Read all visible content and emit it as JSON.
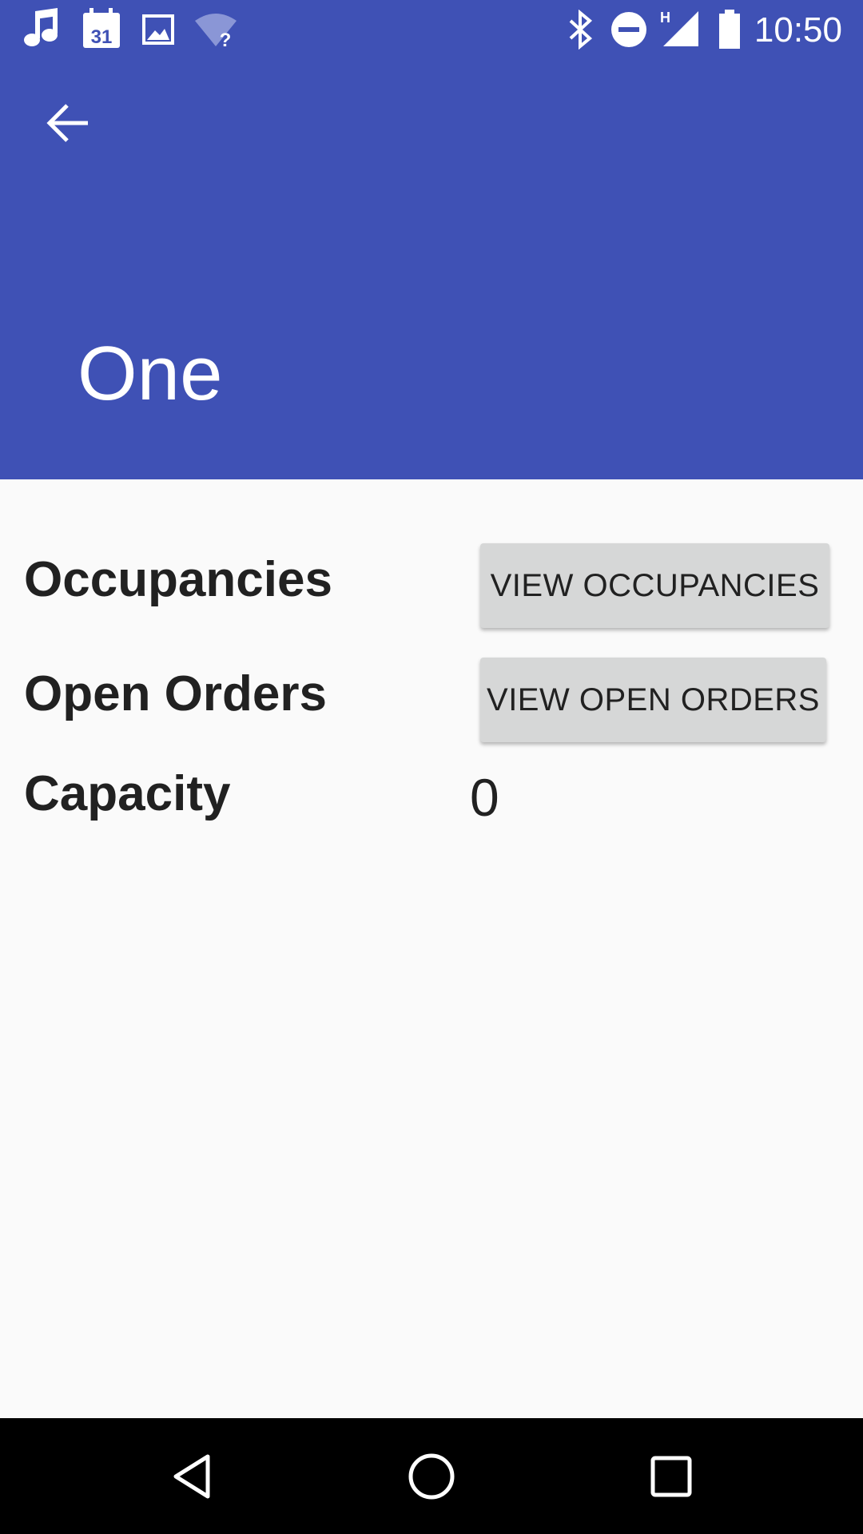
{
  "status_bar": {
    "time": "10:50",
    "calendar_day": "31",
    "left_icons": [
      "music-note-icon",
      "calendar-icon",
      "image-icon",
      "wifi-unknown-icon"
    ],
    "right_icons": [
      "bluetooth-icon",
      "do-not-disturb-icon",
      "signal-icon",
      "battery-icon"
    ]
  },
  "header": {
    "title": "One",
    "back_icon": "arrow-back-icon",
    "color": "#3f51b5"
  },
  "content": {
    "occupancies_label": "Occupancies",
    "view_occupancies_button": "VIEW OCCUPANCIES",
    "open_orders_label": "Open Orders",
    "view_open_orders_button": "VIEW OPEN ORDERS",
    "capacity_label": "Capacity",
    "capacity_value": "0"
  },
  "nav_bar": {
    "icons": [
      "back-triangle-icon",
      "home-circle-icon",
      "recents-square-icon"
    ]
  }
}
